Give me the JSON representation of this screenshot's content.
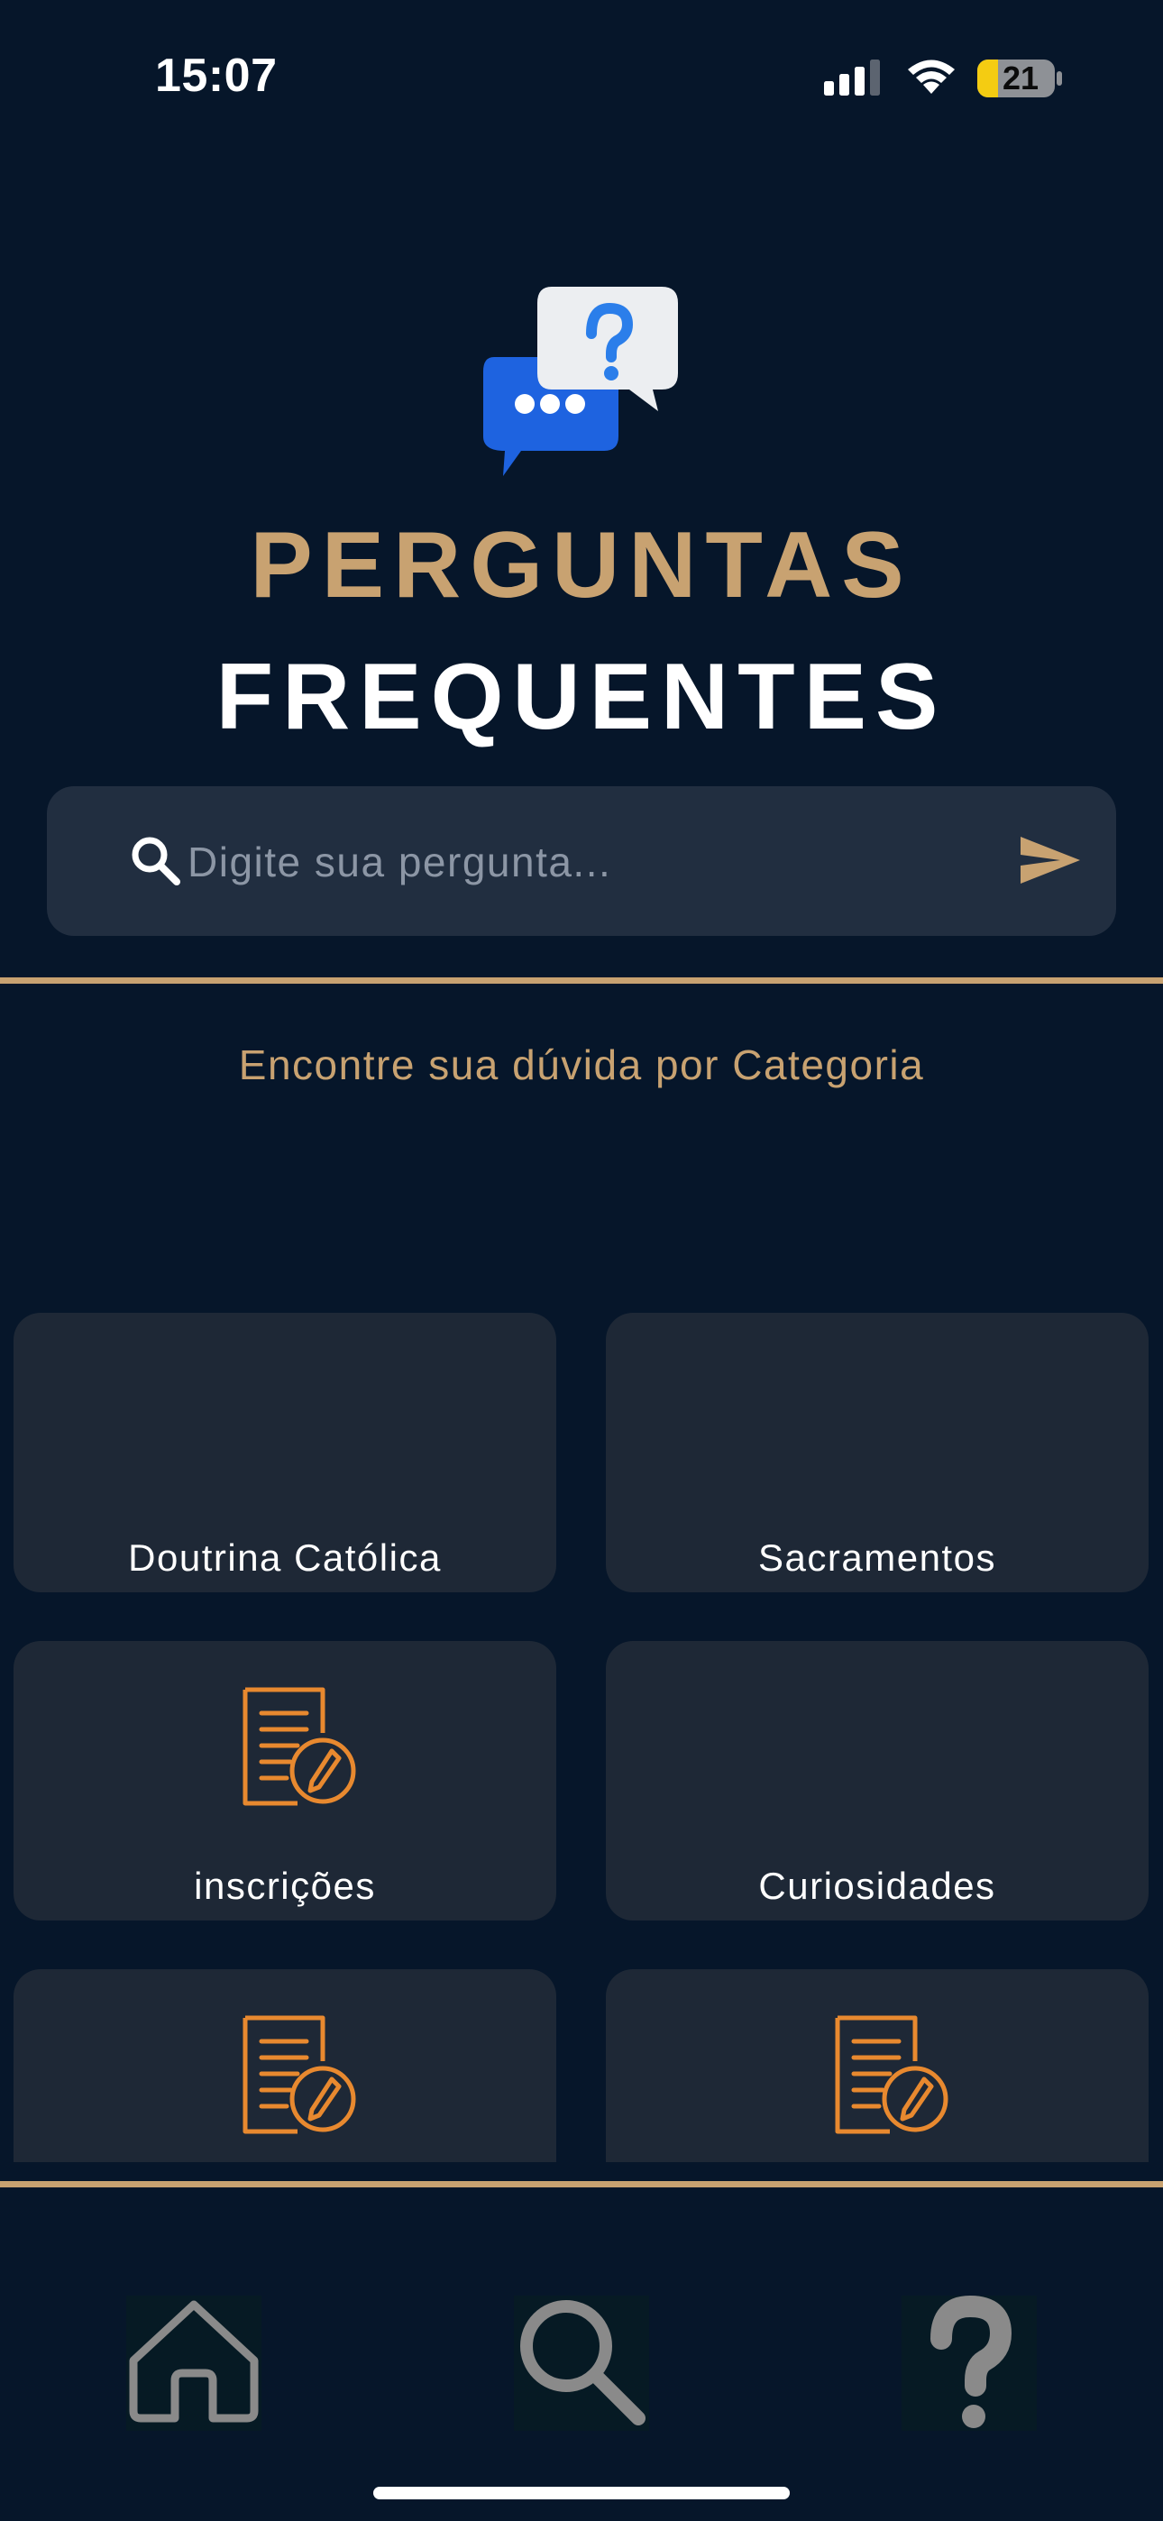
{
  "status_bar": {
    "time": "15:07",
    "battery_level": "21",
    "icons": [
      "signal-icon",
      "wifi-icon",
      "battery-icon"
    ]
  },
  "header": {
    "logo_icon": "faq-chat-bubbles-icon",
    "title_line1": "PERGUNTAS",
    "title_line2": "FREQUENTES"
  },
  "search": {
    "placeholder": "Digite sua pergunta...",
    "value": "",
    "search_icon": "search-icon",
    "submit_icon": "send-icon"
  },
  "categories": {
    "heading": "Encontre sua dúvida por Categoria",
    "items": [
      {
        "label": "Doutrina Católica",
        "icon": ""
      },
      {
        "label": "Sacramentos",
        "icon": ""
      },
      {
        "label": "inscrições",
        "icon": "form-edit-icon"
      },
      {
        "label": "Curiosidades",
        "icon": ""
      },
      {
        "label": "",
        "icon": "form-edit-icon"
      },
      {
        "label": "",
        "icon": "form-edit-icon"
      }
    ]
  },
  "bottom_nav": {
    "items": [
      {
        "name": "home",
        "icon": "home-icon"
      },
      {
        "name": "search",
        "icon": "search-icon"
      },
      {
        "name": "help",
        "icon": "question-mark-icon"
      }
    ]
  },
  "colors": {
    "background": "#06162A",
    "accent_gold": "#C8A271",
    "card_background": "#1E2836",
    "search_background": "#212E40",
    "icon_orange": "#E8892F",
    "logo_blue": "#1E63E0",
    "nav_icon_gray": "#8A8A8A"
  }
}
